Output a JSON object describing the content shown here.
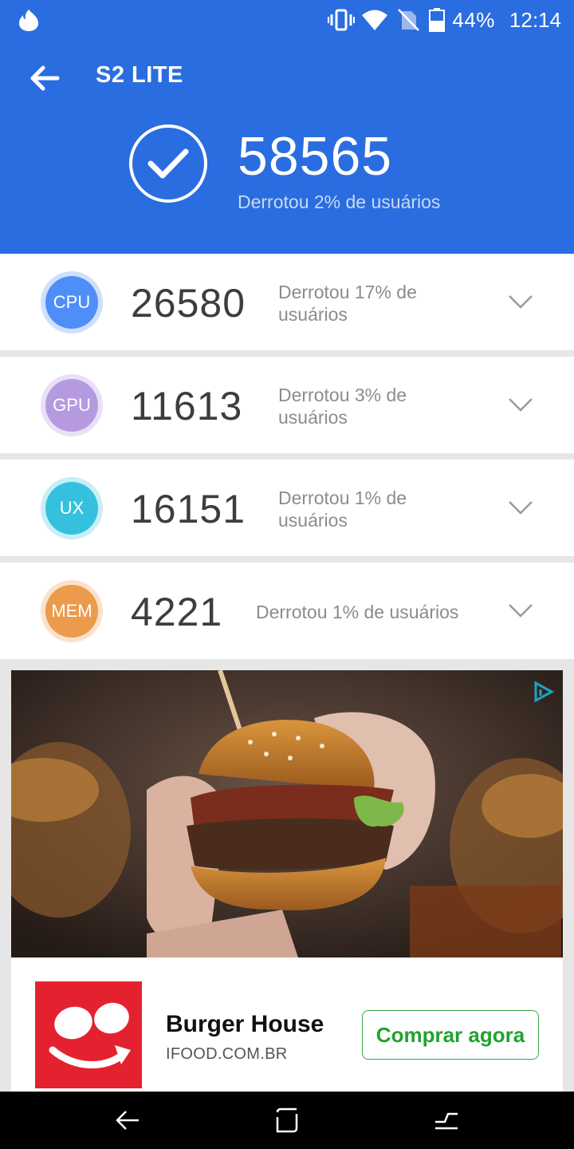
{
  "status_bar": {
    "battery_percent": "44%",
    "time": "12:14",
    "icons": [
      "app-notification-icon",
      "vibrate-icon",
      "wifi-icon",
      "no-sim-icon",
      "battery-icon"
    ]
  },
  "header": {
    "title": "S2 LITE",
    "back_icon": "arrow-left-icon",
    "total_score": "58565",
    "total_subtitle": "Derrotou 2% de usuários",
    "accent_color": "#2a6de0"
  },
  "results": [
    {
      "label": "CPU",
      "score": "26580",
      "description": "Derrotou 17% de usuários",
      "color": "#4f8ef7"
    },
    {
      "label": "GPU",
      "score": "11613",
      "description": "Derrotou 3% de usuários",
      "color": "#b69ae0"
    },
    {
      "label": "UX",
      "score": "16151",
      "description": "Derrotou 1% de usuários",
      "color": "#35c1de"
    },
    {
      "label": "MEM",
      "score": "4221",
      "description": "Derrotou 1% de usuários",
      "color": "#ec9a4c"
    }
  ],
  "ad": {
    "title": "Burger House",
    "domain": "IFOOD.COM.BR",
    "cta": "Comprar agora",
    "image_subject": "burger-photo",
    "brand_color": "#e4222f",
    "cta_color": "#21a330"
  },
  "nav_bar": {
    "buttons": [
      "back-nav-icon",
      "home-nav-icon",
      "recents-nav-icon"
    ]
  }
}
